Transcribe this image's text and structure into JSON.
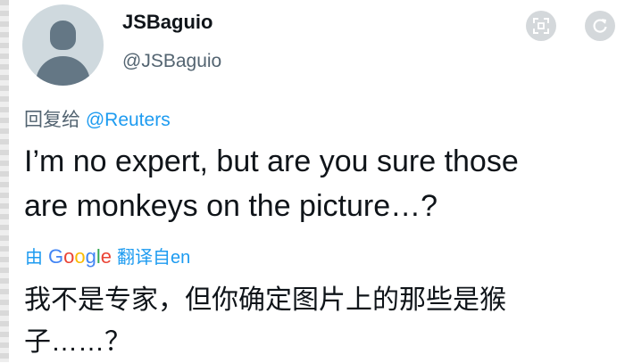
{
  "user": {
    "display_name": "JSBaguio",
    "handle": "@JSBaguio"
  },
  "icons": {
    "avatar": "default-avatar-icon",
    "left": "focus-icon",
    "right": "refresh-icon"
  },
  "reply": {
    "prefix": "回复给",
    "mention": "@Reuters"
  },
  "tweet": {
    "line1": "I’m no expert, but are you sure those",
    "line2": "are monkeys on the picture…?"
  },
  "translation": {
    "by": "由",
    "google_letters": [
      "G",
      "o",
      "o",
      "g",
      "l",
      "e"
    ],
    "translated_from": "翻译自en",
    "line1": "我不是专家，但你确定图片上的那些是猴",
    "line2": "子……？"
  },
  "colors": {
    "link": "#1d9bf0",
    "secondary_text": "#536471",
    "primary_text": "#0f1419"
  }
}
